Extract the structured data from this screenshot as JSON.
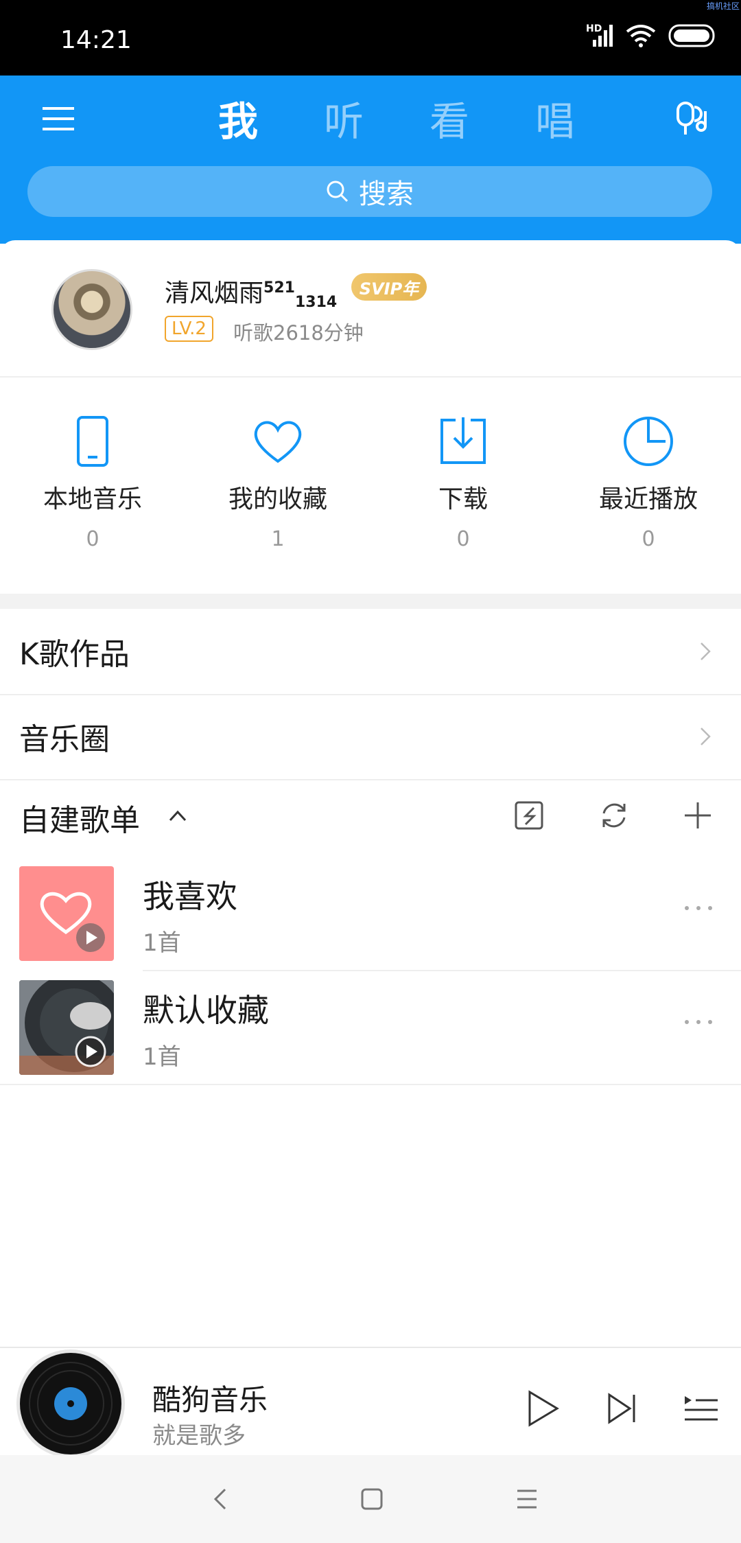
{
  "status_bar": {
    "time": "14:21",
    "network": "HD",
    "watermark": "搞机社区"
  },
  "header": {
    "tabs": [
      {
        "label": "我",
        "active": true
      },
      {
        "label": "听",
        "active": false
      },
      {
        "label": "看",
        "active": false
      },
      {
        "label": "唱",
        "active": false
      }
    ],
    "search_placeholder": "搜索",
    "accent_color": "#1296f6"
  },
  "profile": {
    "name": "清风烟雨",
    "name_sup": "521",
    "name_sub": "1314",
    "vip_badge": "SVIP年",
    "level": "LV.2",
    "listen_time": "听歌2618分钟"
  },
  "quick_access": [
    {
      "icon": "phone-icon",
      "label": "本地音乐",
      "count": "0"
    },
    {
      "icon": "heart-icon",
      "label": "我的收藏",
      "count": "1"
    },
    {
      "icon": "download-icon",
      "label": "下载",
      "count": "0"
    },
    {
      "icon": "clock-icon",
      "label": "最近播放",
      "count": "0"
    }
  ],
  "menu_rows": [
    {
      "label": "K歌作品"
    },
    {
      "label": "音乐圈"
    }
  ],
  "playlists": {
    "title": "自建歌单",
    "items": [
      {
        "name": "我喜欢",
        "count": "1首",
        "cover": "heart-cover"
      },
      {
        "name": "默认收藏",
        "count": "1首",
        "cover": "vinyl-cover"
      }
    ]
  },
  "player": {
    "song": "酷狗音乐",
    "subtitle": "就是歌多"
  }
}
